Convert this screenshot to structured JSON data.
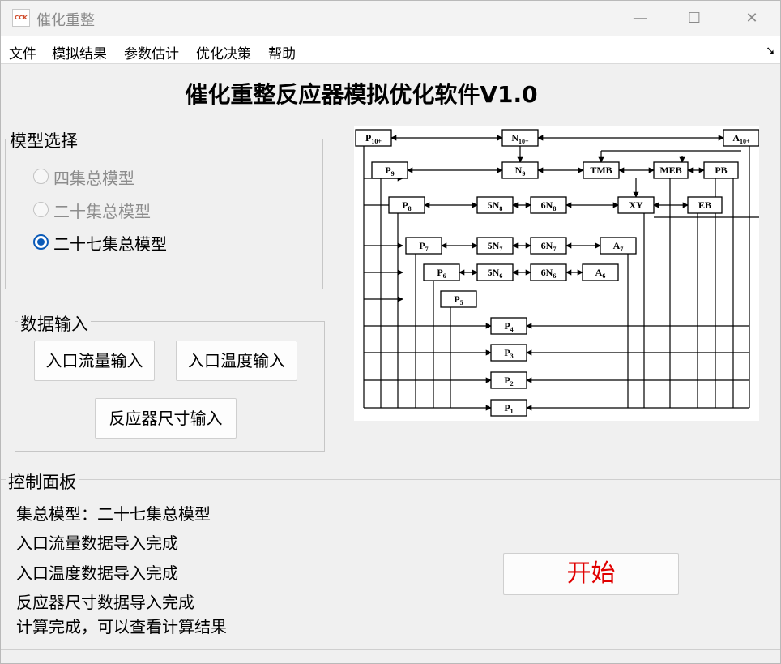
{
  "window": {
    "icon_text": "CCK",
    "title": "催化重整",
    "controls": {
      "minimize": "—",
      "maximize": "☐",
      "close": "✕"
    }
  },
  "menu": [
    "文件",
    "模拟结果",
    "参数估计",
    "优化决策",
    "帮助"
  ],
  "menu_corner_icon": "resize-corner-icon",
  "main_title": "催化重整反应器模拟优化软件V1.0",
  "model_selection": {
    "title": "模型选择",
    "options": [
      {
        "label": "四集总模型",
        "state": "disabled"
      },
      {
        "label": "二十集总模型",
        "state": "disabled"
      },
      {
        "label": "二十七集总模型",
        "state": "checked"
      }
    ]
  },
  "data_input": {
    "title": "数据输入",
    "buttons": [
      "入口流量输入",
      "入口温度输入",
      "反应器尺寸输入"
    ]
  },
  "control_panel": {
    "title": "控制面板",
    "messages": [
      "集总模型：二十七集总模型",
      "入口流量数据导入完成",
      "入口温度数据导入完成",
      "反应器尺寸数据导入完成",
      "计算完成，可以查看计算结果"
    ],
    "start_label": "开始"
  },
  "diagram": {
    "nodes": [
      {
        "id": "P10",
        "base": "P",
        "sub": "10+"
      },
      {
        "id": "N10",
        "base": "N",
        "sub": "10+"
      },
      {
        "id": "A10",
        "base": "A",
        "sub": "10+"
      },
      {
        "id": "P9",
        "base": "P",
        "sub": "9"
      },
      {
        "id": "N9",
        "base": "N",
        "sub": "9"
      },
      {
        "id": "TMB",
        "base": "TMB",
        "sub": ""
      },
      {
        "id": "MEB",
        "base": "MEB",
        "sub": ""
      },
      {
        "id": "PB",
        "base": "PB",
        "sub": ""
      },
      {
        "id": "P8",
        "base": "P",
        "sub": "8"
      },
      {
        "id": "5N8",
        "base": "5N",
        "sub": "8"
      },
      {
        "id": "6N8",
        "base": "6N",
        "sub": "8"
      },
      {
        "id": "XY",
        "base": "XY",
        "sub": ""
      },
      {
        "id": "EB",
        "base": "EB",
        "sub": ""
      },
      {
        "id": "P7",
        "base": "P",
        "sub": "7"
      },
      {
        "id": "5N7",
        "base": "5N",
        "sub": "7"
      },
      {
        "id": "6N7",
        "base": "6N",
        "sub": "7"
      },
      {
        "id": "A7",
        "base": "A",
        "sub": "7"
      },
      {
        "id": "P6",
        "base": "P",
        "sub": "6"
      },
      {
        "id": "5N6",
        "base": "5N",
        "sub": "6"
      },
      {
        "id": "6N6",
        "base": "6N",
        "sub": "6"
      },
      {
        "id": "A6",
        "base": "A",
        "sub": "6"
      },
      {
        "id": "P5",
        "base": "P",
        "sub": "5"
      },
      {
        "id": "P4",
        "base": "P",
        "sub": "4"
      },
      {
        "id": "P3",
        "base": "P",
        "sub": "3"
      },
      {
        "id": "P2",
        "base": "P",
        "sub": "2"
      },
      {
        "id": "P1",
        "base": "P",
        "sub": "1"
      }
    ]
  }
}
